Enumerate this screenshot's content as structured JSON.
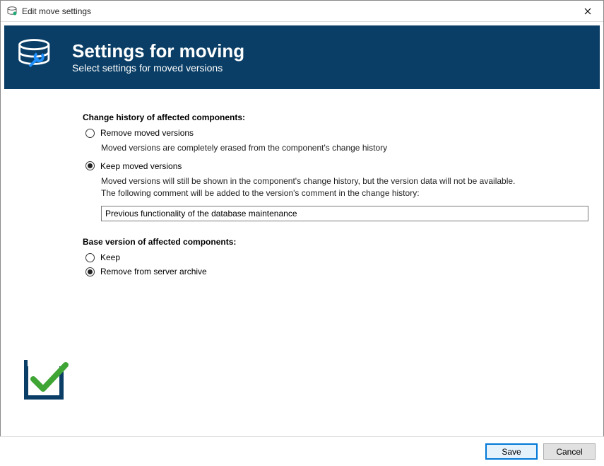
{
  "window": {
    "title": "Edit move settings"
  },
  "header": {
    "title": "Settings for moving",
    "subtitle": "Select settings for moved versions"
  },
  "history": {
    "section_title": "Change history of affected components:",
    "remove": {
      "label": "Remove moved versions",
      "desc": "Moved versions are completely erased from the component's change history",
      "selected": false
    },
    "keep": {
      "label": "Keep moved versions",
      "desc_line1": "Moved versions will still be shown in the component's change history, but the version data will not be available.",
      "desc_line2": "The following comment will be added to the version's comment in the change history:",
      "selected": true,
      "comment_value": "Previous functionality of the database maintenance"
    }
  },
  "base": {
    "section_title": "Base version of affected components:",
    "keep": {
      "label": "Keep",
      "selected": false
    },
    "remove": {
      "label": "Remove from server archive",
      "selected": true
    }
  },
  "buttons": {
    "save": "Save",
    "cancel": "Cancel"
  }
}
